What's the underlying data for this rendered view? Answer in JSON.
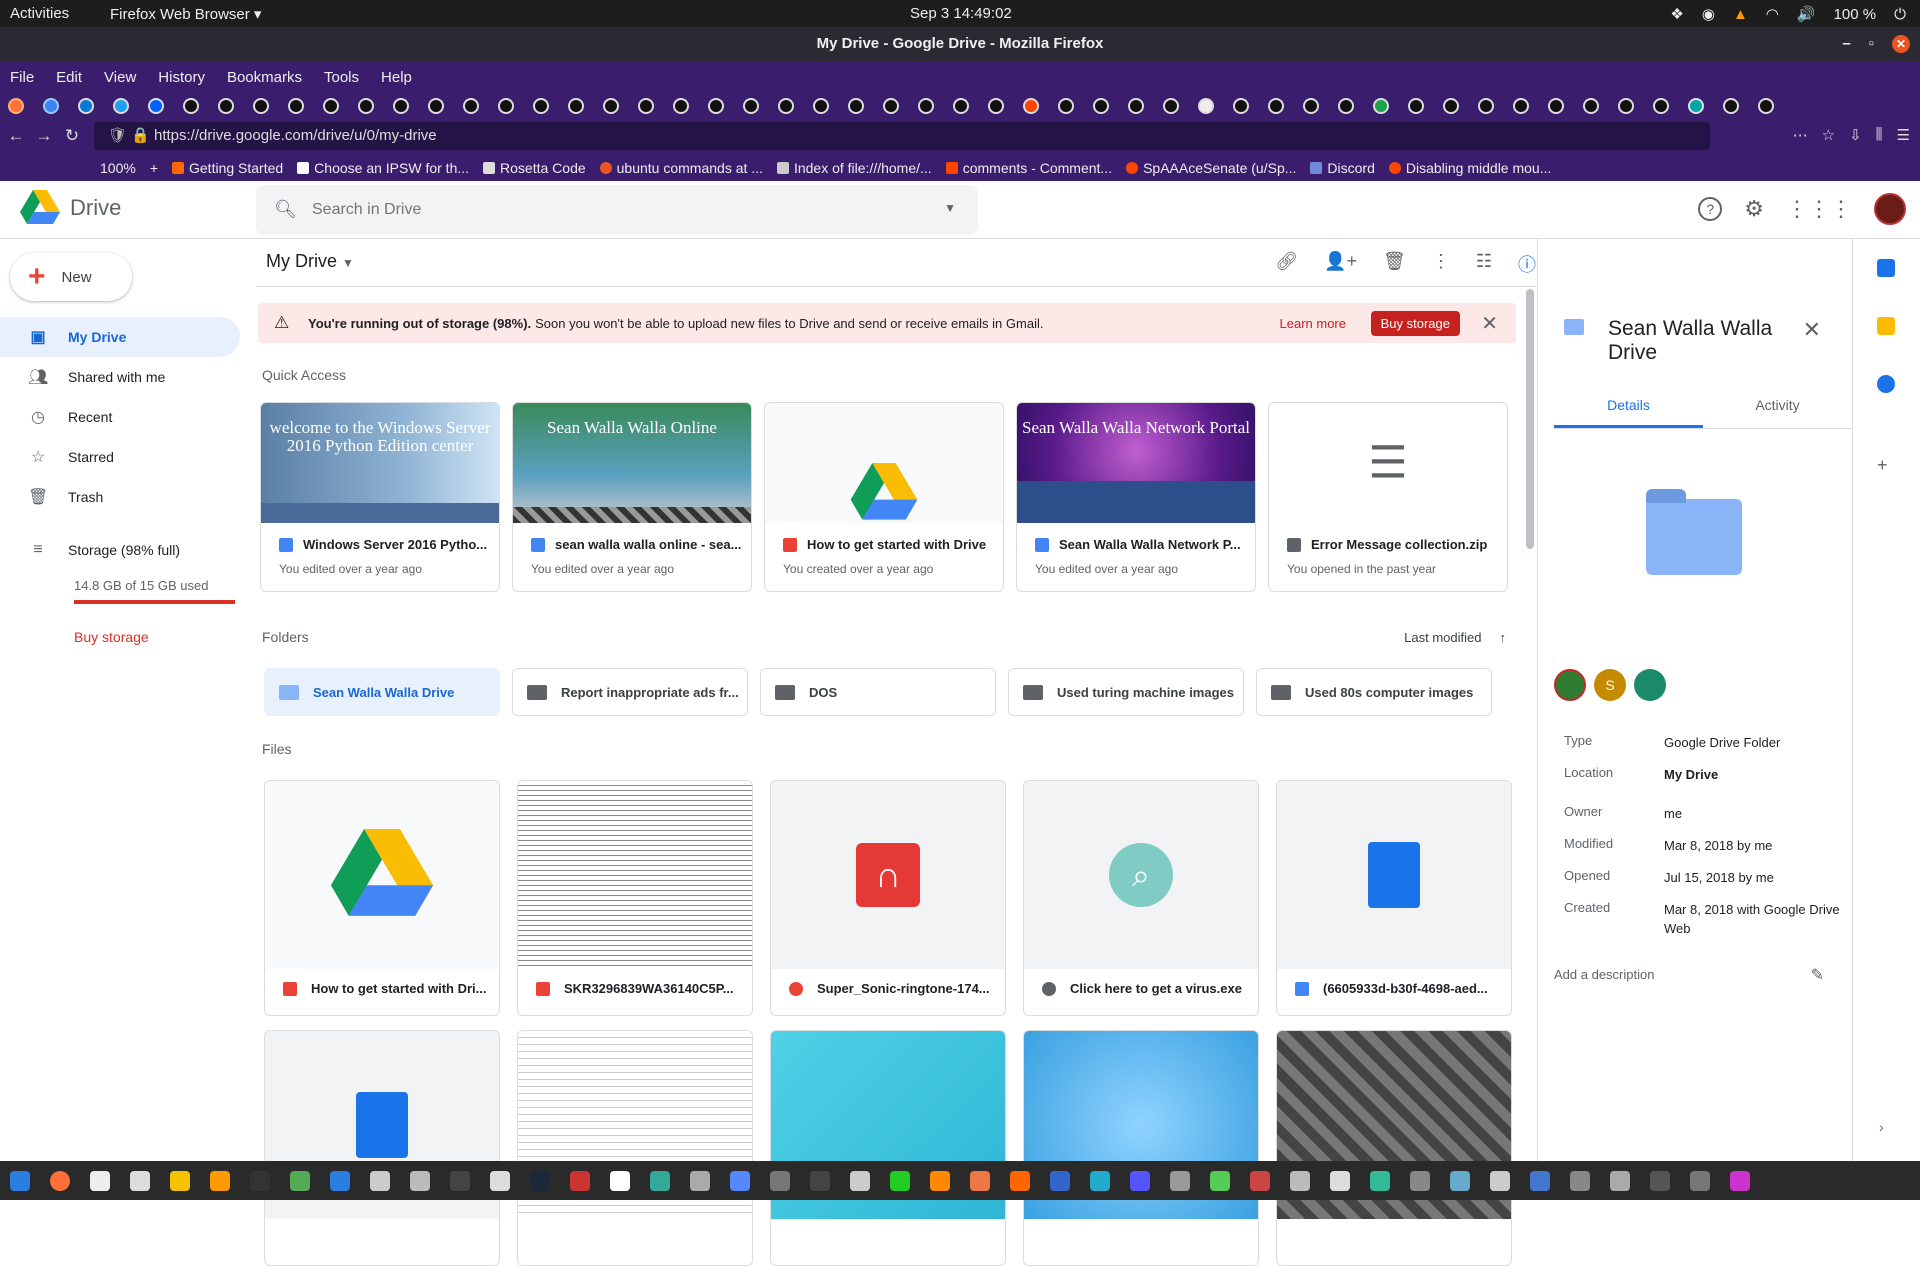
{
  "system": {
    "activities": "Activities",
    "app_menu": "Firefox Web Browser ▾",
    "clock": "Sep 3  14:49:02",
    "battery": "100 %"
  },
  "window": {
    "title": "My Drive - Google Drive - Mozilla Firefox"
  },
  "menus": [
    "File",
    "Edit",
    "View",
    "History",
    "Bookmarks",
    "Tools",
    "Help"
  ],
  "browser": {
    "url": "https://drive.google.com/drive/u/0/my-drive",
    "zoom": "100%",
    "bookmarks": [
      "Getting Started",
      "Choose an IPSW for th...",
      "Rosetta Code",
      "ubuntu commands at ...",
      "Index of file:///home/...",
      "comments - Comment...",
      "SpAAAceSenate (u/Sp...",
      "Discord",
      "Disabling middle mou..."
    ]
  },
  "drive": {
    "logo": "Drive",
    "search_placeholder": "Search in Drive",
    "new_button": "New",
    "nav": {
      "my_drive": "My Drive",
      "shared": "Shared with me",
      "recent": "Recent",
      "starred": "Starred",
      "trash": "Trash",
      "storage": "Storage (98% full)",
      "storage_used": "14.8 GB of 15 GB used",
      "buy_storage": "Buy storage"
    },
    "storage_fraction": 0.98,
    "main_title": "My Drive",
    "banner": {
      "bold": "You're running out of storage (98%).",
      "text": "Soon you won't be able to upload new files to Drive and send or receive emails in Gmail.",
      "learn_more": "Learn more",
      "buy": "Buy storage"
    },
    "quick_access_label": "Quick Access",
    "quick_access": [
      {
        "name": "Windows Server 2016 Pytho...",
        "sub": "You edited over a year ago",
        "thumb_text": "welcome to the Windows Server 2016 Python Edition center",
        "icon": "doc"
      },
      {
        "name": "sean walla walla online - sea...",
        "sub": "You edited over a year ago",
        "thumb_text": "Sean Walla Walla Online",
        "icon": "doc"
      },
      {
        "name": "How to get started with Drive",
        "sub": "You created over a year ago",
        "thumb_text": "",
        "icon": "pdf"
      },
      {
        "name": "Sean Walla Walla Network P...",
        "sub": "You edited over a year ago",
        "thumb_text": "Sean Walla Walla Network Portal",
        "icon": "doc"
      },
      {
        "name": "Error Message collection.zip",
        "sub": "You opened in the past year",
        "thumb_text": "",
        "icon": "zip"
      }
    ],
    "folders_label": "Folders",
    "sort_label": "Last modified",
    "folders": [
      "Sean Walla Walla Drive",
      "Report inappropriate ads fr...",
      "DOS",
      "Used turing machine images",
      "Used 80s computer images"
    ],
    "files_label": "Files",
    "files": [
      {
        "name": "How to get started with Dri...",
        "icon": "pdf"
      },
      {
        "name": "SKR3296839WA36140C5P...",
        "icon": "pdf"
      },
      {
        "name": "Super_Sonic-ringtone-174...",
        "icon": "aud"
      },
      {
        "name": "Click here to get a virus.exe",
        "icon": "app"
      },
      {
        "name": "(6605933d-b30f-4698-aed...",
        "icon": "doc"
      }
    ]
  },
  "details": {
    "title": "Sean Walla Walla Drive",
    "tab_details": "Details",
    "tab_activity": "Activity",
    "sharer_initial": "S",
    "props": [
      {
        "k": "Type",
        "v": "Google Drive Folder"
      },
      {
        "k": "Location",
        "v": "My Drive"
      },
      {
        "k": "Owner",
        "v": "me"
      },
      {
        "k": "Modified",
        "v": "Mar 8, 2018 by me"
      },
      {
        "k": "Opened",
        "v": "Jul 15, 2018 by me"
      },
      {
        "k": "Created",
        "v": "Mar 8, 2018 with Google Drive Web"
      }
    ],
    "add_description": "Add a description"
  },
  "colors": {
    "accent": "#1a73e8",
    "danger": "#d93025",
    "firefox_theme": "#3b1d6e"
  }
}
